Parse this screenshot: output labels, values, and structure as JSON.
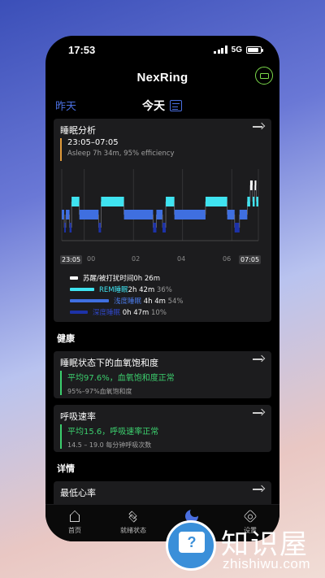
{
  "status_bar": {
    "time": "17:53",
    "network": "5G"
  },
  "app": {
    "title": "NexRing"
  },
  "day_tabs": {
    "yesterday": "昨天",
    "today": "今天"
  },
  "sleep_card": {
    "title": "睡眠分析",
    "time_range": "23:05–07:05",
    "summary": "Asleep 7h 34m, 95% efficiency",
    "x_start": "23:05",
    "x_ticks": [
      "00",
      "02",
      "04",
      "06"
    ],
    "x_end": "07:05",
    "legend": [
      {
        "label": "苏醒/被打扰时间",
        "value": "0h 26m",
        "percent": "",
        "color": "#ffffff"
      },
      {
        "label": "REM睡眠",
        "value": "2h 42m",
        "percent": "36%",
        "color": "#3fe3f0"
      },
      {
        "label": "浅度睡眠",
        "value": "4h 4m",
        "percent": "54%",
        "color": "#3f6fe0"
      },
      {
        "label": "深度睡眠",
        "value": "0h 47m",
        "percent": "10%",
        "color": "#1d32a8"
      }
    ]
  },
  "chart_data": {
    "type": "bar",
    "title": "睡眠分析",
    "x_range": [
      "23:05",
      "07:05"
    ],
    "x_ticks": [
      "23:05",
      "00",
      "02",
      "04",
      "06",
      "07:05"
    ],
    "stages": [
      "Awake",
      "REM",
      "Light",
      "Deep"
    ],
    "hypnogram": [
      {
        "start": "23:05",
        "end": "23:11",
        "stage": "Light"
      },
      {
        "start": "23:11",
        "end": "23:15",
        "stage": "Deep"
      },
      {
        "start": "23:15",
        "end": "23:24",
        "stage": "Light"
      },
      {
        "start": "23:24",
        "end": "23:29",
        "stage": "Deep"
      },
      {
        "start": "23:29",
        "end": "23:48",
        "stage": "REM"
      },
      {
        "start": "23:48",
        "end": "00:35",
        "stage": "Light"
      },
      {
        "start": "00:35",
        "end": "00:41",
        "stage": "Deep"
      },
      {
        "start": "00:41",
        "end": "01:37",
        "stage": "REM"
      },
      {
        "start": "01:37",
        "end": "02:48",
        "stage": "Light"
      },
      {
        "start": "02:48",
        "end": "02:56",
        "stage": "Deep"
      },
      {
        "start": "02:56",
        "end": "03:11",
        "stage": "Light"
      },
      {
        "start": "03:11",
        "end": "03:19",
        "stage": "Deep"
      },
      {
        "start": "03:19",
        "end": "03:40",
        "stage": "REM"
      },
      {
        "start": "03:40",
        "end": "04:56",
        "stage": "Light"
      },
      {
        "start": "04:56",
        "end": "05:49",
        "stage": "REM"
      },
      {
        "start": "05:49",
        "end": "06:07",
        "stage": "Light"
      },
      {
        "start": "06:07",
        "end": "06:19",
        "stage": "Deep"
      },
      {
        "start": "06:19",
        "end": "06:38",
        "stage": "Light"
      },
      {
        "start": "06:38",
        "end": "06:45",
        "stage": "REM"
      },
      {
        "start": "06:45",
        "end": "06:51",
        "stage": "Awake"
      },
      {
        "start": "06:51",
        "end": "06:56",
        "stage": "REM"
      },
      {
        "start": "06:56",
        "end": "07:00",
        "stage": "Awake"
      },
      {
        "start": "07:00",
        "end": "07:05",
        "stage": "REM"
      }
    ],
    "grid": true
  },
  "health": {
    "heading": "健康"
  },
  "spo2_card": {
    "title": "睡眠状态下的血氧饱和度",
    "main": "平均97.6%，血氧饱和度正常",
    "sub": "95%–97%血氧饱和度"
  },
  "resp_card": {
    "title": "呼吸速率",
    "main": "平均15.6，呼吸速率正常",
    "sub": "14.5 – 19.0 每分钟呼吸次数"
  },
  "details": {
    "heading": "详情"
  },
  "min_hr_card": {
    "title": "最低心率"
  },
  "nav": {
    "items": [
      {
        "label": "首页",
        "icon": "home-icon"
      },
      {
        "label": "就绪状态",
        "icon": "layers-icon"
      },
      {
        "label": "睡眠",
        "icon": "moon-icon"
      },
      {
        "label": "设置",
        "icon": "gear-icon"
      }
    ]
  },
  "watermark": {
    "text": "知识屋",
    "url": "zhishiwu.com"
  },
  "colors": {
    "accent": "#3b63d8",
    "rem": "#3fe3f0",
    "light": "#3f6fe0",
    "deep": "#1d32a8",
    "awake": "#ffffff",
    "ok": "#3ccf6e",
    "summary_bar": "#e09a3a"
  }
}
